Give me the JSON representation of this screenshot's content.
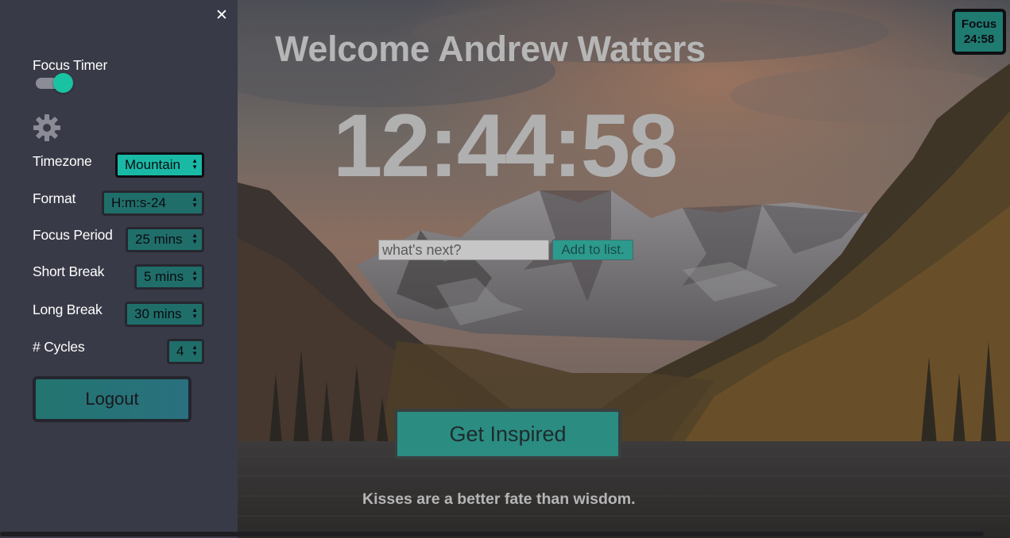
{
  "sidebar": {
    "close_icon": "close-icon",
    "focus_timer_label": "Focus Timer",
    "focus_timer_enabled": true,
    "settings_icon": "gear-icon",
    "settings": [
      {
        "label": "Timezone",
        "value": "Mountain"
      },
      {
        "label": "Format",
        "value": "H:m:s-24"
      },
      {
        "label": "Focus Period",
        "value": "25 mins"
      },
      {
        "label": "Short Break",
        "value": "5 mins"
      },
      {
        "label": "Long Break",
        "value": "30 mins"
      },
      {
        "label": "# Cycles",
        "value": "4"
      }
    ],
    "logout_label": "Logout"
  },
  "main": {
    "welcome": "Welcome Andrew Watters",
    "clock": "12:44:58",
    "todo_placeholder": "what's next?",
    "add_button": "Add to list.",
    "inspire_button": "Get Inspired",
    "quote": "Kisses are a better fate than wisdom."
  },
  "focus_badge": {
    "line1": "Focus",
    "line2": "24:58"
  },
  "colors": {
    "accent": "#19c2a1",
    "sidebar_bg": "#393a47",
    "teal_button": "#2b8c82"
  }
}
